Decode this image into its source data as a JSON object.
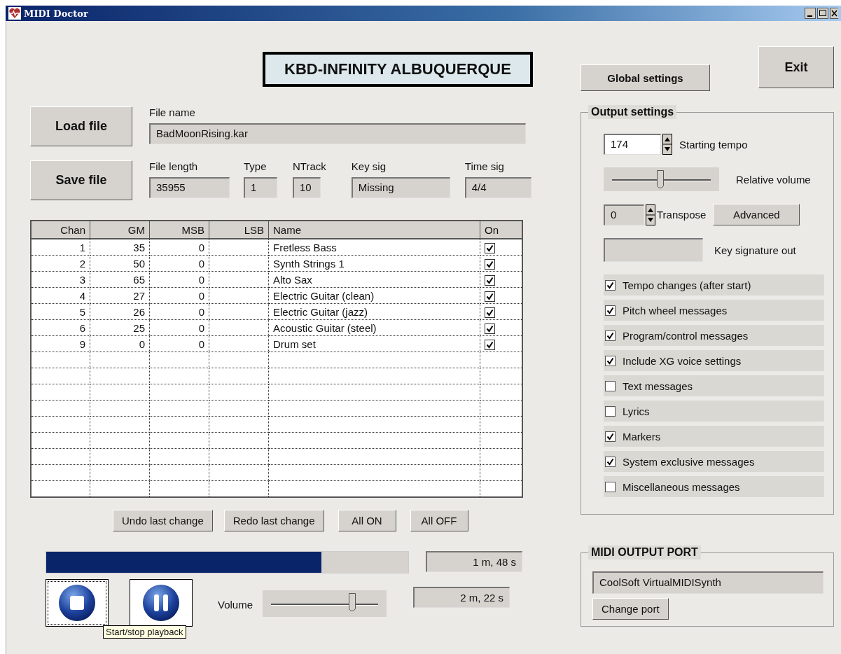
{
  "window": {
    "title": "MIDI Doctor"
  },
  "banner": "KBD-INFINITY ALBUQUERQUE",
  "buttons": {
    "load": "Load file",
    "save": "Save file",
    "global_settings": "Global settings",
    "exit": "Exit"
  },
  "file": {
    "name_label": "File name",
    "name": "BadMoonRising.kar",
    "fields": [
      {
        "label": "File length",
        "value": "35955"
      },
      {
        "label": "Type",
        "value": "1"
      },
      {
        "label": "NTrack",
        "value": "10"
      },
      {
        "label": "Key sig",
        "value": "Missing"
      },
      {
        "label": "Time sig",
        "value": "4/4"
      }
    ]
  },
  "table": {
    "columns": [
      "Chan",
      "GM",
      "MSB",
      "LSB",
      "Name",
      "On"
    ],
    "rows": [
      {
        "chan": "1",
        "gm": "35",
        "msb": "0",
        "name": "Fretless Bass",
        "on": true
      },
      {
        "chan": "2",
        "gm": "50",
        "msb": "0",
        "name": "Synth Strings 1",
        "on": true
      },
      {
        "chan": "3",
        "gm": "65",
        "msb": "0",
        "name": "Alto Sax",
        "on": true
      },
      {
        "chan": "4",
        "gm": "27",
        "msb": "0",
        "name": "Electric Guitar (clean)",
        "on": true
      },
      {
        "chan": "5",
        "gm": "26",
        "msb": "0",
        "name": "Electric Guitar (jazz)",
        "on": true
      },
      {
        "chan": "6",
        "gm": "25",
        "msb": "0",
        "name": "Acoustic Guitar (steel)",
        "on": true
      },
      {
        "chan": "9",
        "gm": "0",
        "msb": "0",
        "name": "Drum set",
        "on": true
      }
    ]
  },
  "table_buttons": [
    "Undo last change",
    "Redo last change",
    "All ON",
    "All OFF"
  ],
  "playback": {
    "progress": {
      "level": 0.76
    },
    "elapsed": "1 m, 48 s",
    "total": "2 m, 22 s",
    "volume_label": "Volume",
    "volume": {
      "level": 0.76
    },
    "tooltip": "Start/stop playback"
  },
  "output_settings": {
    "title": "Output settings",
    "tempo": "174",
    "tempo_label": "Starting tempo",
    "relative_volume": {
      "level": 0.49
    },
    "relative_volume_label": "Relative volume",
    "transpose": "0",
    "transpose_label": "Transpose",
    "advanced": "Advanced",
    "key_signature_label": "Key signature out",
    "options": [
      {
        "label": "Tempo changes (after start)",
        "checked": true
      },
      {
        "label": "Pitch wheel messages",
        "checked": true
      },
      {
        "label": "Program/control messages",
        "checked": true
      },
      {
        "label": "Include XG voice settings",
        "checked": true
      },
      {
        "label": "Text messages",
        "checked": false
      },
      {
        "label": "Lyrics",
        "checked": false
      },
      {
        "label": "Markers",
        "checked": true
      },
      {
        "label": "System exclusive messages",
        "checked": true
      },
      {
        "label": "Miscellaneous messages",
        "checked": false
      }
    ]
  },
  "midi_output_port": {
    "title": "MIDI OUTPUT PORT",
    "port": "CoolSoft VirtualMIDISynth",
    "change": "Change port"
  }
}
